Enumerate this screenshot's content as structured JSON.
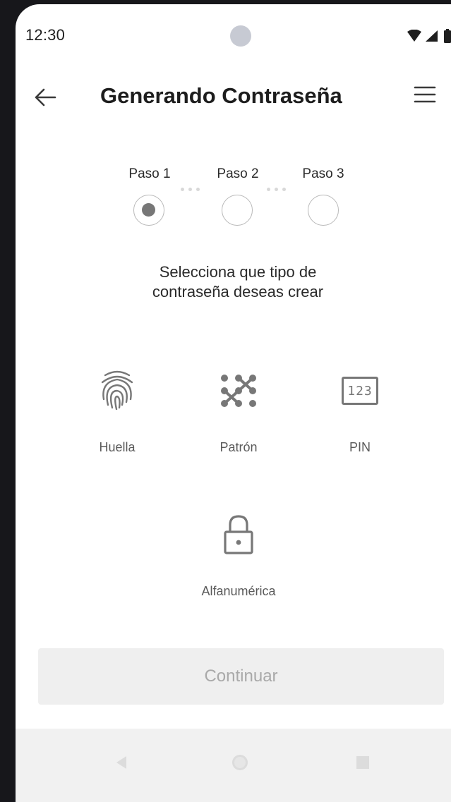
{
  "status_bar": {
    "time": "12:30",
    "icons": [
      "wifi-icon",
      "signal-icon",
      "battery-icon"
    ]
  },
  "app_bar": {
    "title": "Generando Contraseña",
    "back_icon": "arrow-left-icon",
    "menu_icon": "hamburger-menu-icon"
  },
  "stepper": {
    "steps": [
      {
        "label": "Paso 1",
        "active": true
      },
      {
        "label": "Paso 2",
        "active": false
      },
      {
        "label": "Paso 3",
        "active": false
      }
    ]
  },
  "instruction": {
    "line1": "Selecciona que tipo de",
    "line2": "contraseña deseas crear"
  },
  "options": [
    {
      "label": "Huella",
      "icon": "fingerprint-icon"
    },
    {
      "label": "Patrón",
      "icon": "pattern-icon"
    },
    {
      "label": "PIN",
      "icon": "pin-123-icon",
      "icon_text": "123"
    },
    {
      "label": "Alfanumérica",
      "icon": "padlock-icon"
    }
  ],
  "continue_button": {
    "label": "Continuar",
    "enabled": false
  },
  "nav_bar": {
    "icons": [
      "nav-back-icon",
      "nav-home-icon",
      "nav-recents-icon"
    ]
  },
  "colors": {
    "background_outer": "#17171b",
    "screen": "#ffffff",
    "icon_gray": "#777777",
    "button_disabled_bg": "#efefef",
    "button_disabled_text": "#a9a9a9",
    "nav_bar_bg": "#f1f1f1"
  }
}
